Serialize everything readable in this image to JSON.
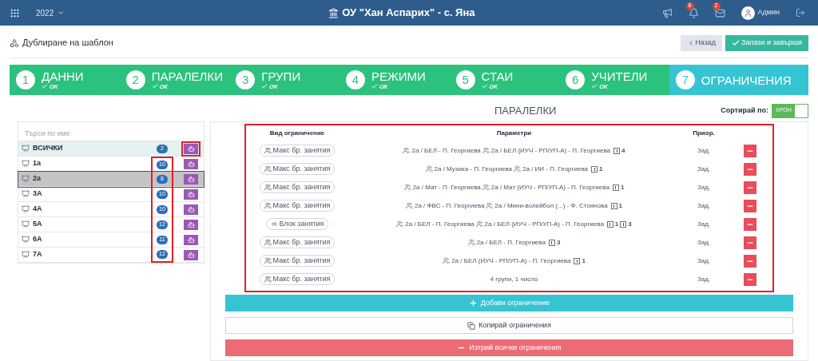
{
  "topbar": {
    "year": "2022",
    "school": "ОУ \"Хан Аспарих\" - с. Яна",
    "notifications": "6",
    "messages": "2",
    "user": "Админ"
  },
  "header": {
    "title": "Дублиране на шаблон",
    "back": "Назад",
    "save": "Запази и завърши"
  },
  "steps": [
    {
      "number": "1",
      "label": "ДАННИ",
      "status": "OK",
      "selected": false
    },
    {
      "number": "2",
      "label": "ПАРАЛЕЛКИ",
      "status": "OK",
      "selected": false
    },
    {
      "number": "3",
      "label": "ГРУПИ",
      "status": "OK",
      "selected": false
    },
    {
      "number": "4",
      "label": "РЕЖИМИ",
      "status": "OK",
      "selected": false
    },
    {
      "number": "5",
      "label": "СТАИ",
      "status": "OK",
      "selected": false
    },
    {
      "number": "6",
      "label": "УЧИТЕЛИ",
      "status": "OK",
      "selected": false
    },
    {
      "number": "7",
      "label": "ОГРАНИЧЕНИЯ",
      "selected": true
    }
  ],
  "classes": {
    "search_placeholder": "Търси по име",
    "highlight_all_button": true,
    "highlight_counts": true,
    "items": [
      {
        "name": "ВСИЧКИ",
        "count": "2",
        "kind": "all",
        "selected": false
      },
      {
        "name": "1а",
        "count": "10",
        "kind": "class",
        "selected": false
      },
      {
        "name": "2а",
        "count": "8",
        "kind": "class",
        "selected": true
      },
      {
        "name": "3А",
        "count": "10",
        "kind": "class",
        "selected": false
      },
      {
        "name": "4А",
        "count": "10",
        "kind": "class",
        "selected": false
      },
      {
        "name": "5А",
        "count": "12",
        "kind": "class",
        "selected": false
      },
      {
        "name": "6А",
        "count": "11",
        "kind": "class",
        "selected": false
      },
      {
        "name": "7А",
        "count": "12",
        "kind": "class",
        "selected": false
      }
    ]
  },
  "panel": {
    "title": "ПАРАЛЕЛКИ",
    "sort_label": "Сортирай по:",
    "sort_toggle": {
      "label": "ХРОН",
      "on": true
    },
    "table": {
      "highlighted": true,
      "columns": [
        "Вид ограничение",
        "Параметри",
        "Приор."
      ],
      "rows": [
        {
          "type": {
            "kind": "max",
            "label": "Макс бр. занятия"
          },
          "params": [
            {
              "kind": "group",
              "text": "2а / БЕЛ - П. Георгиева"
            },
            {
              "kind": "group",
              "text": "2а / БЕЛ (ИУЧ - РП/УП-А) - П. Георгиева"
            },
            {
              "kind": "count",
              "text": "4"
            }
          ],
          "priority": "Зад."
        },
        {
          "type": {
            "kind": "max",
            "label": "Макс бр. занятия"
          },
          "params": [
            {
              "kind": "group",
              "text": "2а / Музика - П. Георгиева"
            },
            {
              "kind": "group",
              "text": "2а / ИИ - П. Георгиева"
            },
            {
              "kind": "count",
              "text": "1"
            }
          ],
          "priority": "Зад."
        },
        {
          "type": {
            "kind": "max",
            "label": "Макс бр. занятия"
          },
          "params": [
            {
              "kind": "group",
              "text": "2а / Мат - П. Георгиева"
            },
            {
              "kind": "group",
              "text": "2а / Мат (ИУЧ - РП/УП-А) - П. Георгиева"
            },
            {
              "kind": "count",
              "text": "1"
            }
          ],
          "priority": "Зад."
        },
        {
          "type": {
            "kind": "max",
            "label": "Макс бр. занятия"
          },
          "params": [
            {
              "kind": "group",
              "text": "2а / ФВС - П. Георгиева"
            },
            {
              "kind": "group",
              "text": "2а / Мини-волейбол (...) - Ф. Стоянова"
            },
            {
              "kind": "count",
              "text": "1"
            }
          ],
          "priority": "Зад."
        },
        {
          "type": {
            "kind": "block",
            "label": "Блок занятия"
          },
          "params": [
            {
              "kind": "group",
              "text": "2а / БЕЛ - П. Георгиева"
            },
            {
              "kind": "group",
              "text": "2а / БЕЛ (ИУЧ - РП/УП-А) - П. Георгиева"
            },
            {
              "kind": "count",
              "text": "1"
            },
            {
              "kind": "count",
              "text": "3"
            }
          ],
          "priority": "Зад."
        },
        {
          "type": {
            "kind": "max",
            "label": "Макс бр. занятия"
          },
          "params": [
            {
              "kind": "group",
              "text": "2а / БЕЛ - П. Георгиева"
            },
            {
              "kind": "count",
              "text": "3"
            }
          ],
          "priority": "Зад."
        },
        {
          "type": {
            "kind": "max",
            "label": "Макс бр. занятия"
          },
          "params": [
            {
              "kind": "group",
              "text": "2а / БЕЛ (ИУЧ - РП/УП-А) - П. Георгиева"
            },
            {
              "kind": "count",
              "text": "1"
            }
          ],
          "priority": "Зад."
        },
        {
          "type": {
            "kind": "max",
            "label": "Макс бр. занятия"
          },
          "params": [
            {
              "kind": "text",
              "text": "4 групи, 1 число"
            }
          ],
          "priority": "Зад."
        }
      ]
    },
    "buttons": [
      {
        "kind": "add",
        "label": "Добави ограничение"
      },
      {
        "kind": "copy",
        "label": "Копирай ограничения"
      },
      {
        "kind": "delete",
        "label": "Изтрий всички ограничения"
      }
    ]
  }
}
